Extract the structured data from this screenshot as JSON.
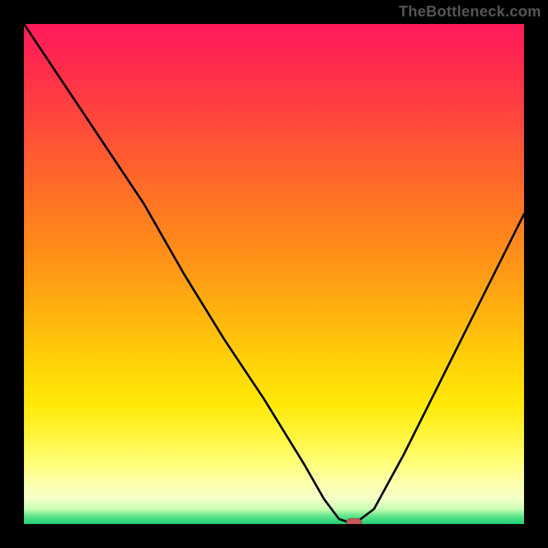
{
  "watermark": "TheBottleneck.com",
  "chart_data": {
    "type": "line",
    "title": "",
    "xlabel": "",
    "ylabel": "",
    "xlim": [
      0,
      100
    ],
    "ylim": [
      0,
      100
    ],
    "series": [
      {
        "name": "bottleneck-curve",
        "x": [
          0,
          8,
          16,
          24,
          32,
          40,
          48,
          56,
          60,
          63,
          66,
          70,
          76,
          84,
          92,
          100
        ],
        "values": [
          100,
          88,
          76,
          64,
          50,
          37,
          25,
          12,
          5,
          1,
          0,
          3,
          14,
          30,
          46,
          62
        ]
      }
    ],
    "marker": {
      "x": 66,
      "y": 0,
      "label": "optimal-point"
    },
    "background_gradient": {
      "orientation": "vertical",
      "stops": [
        {
          "pos": 0.0,
          "color": "#ff1a5c"
        },
        {
          "pos": 0.22,
          "color": "#ff4f38"
        },
        {
          "pos": 0.46,
          "color": "#ff8f18"
        },
        {
          "pos": 0.68,
          "color": "#ffd308"
        },
        {
          "pos": 0.88,
          "color": "#ffff7a"
        },
        {
          "pos": 0.97,
          "color": "#c8ffb4"
        },
        {
          "pos": 1.0,
          "color": "#1fcf77"
        }
      ]
    }
  }
}
